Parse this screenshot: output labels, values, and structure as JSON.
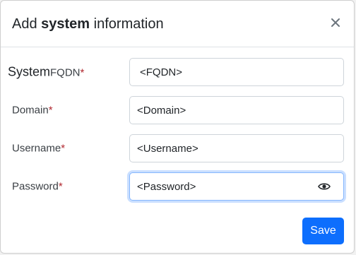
{
  "dialog": {
    "title_prefix": "Add ",
    "title_bold": "system",
    "title_suffix": "information",
    "close_glyph": "×",
    "save_label": "Save"
  },
  "fields": [
    {
      "label_big": "System",
      "label_small": "FQDN",
      "required_mark": "*",
      "value": "<FQDN>"
    },
    {
      "label": "Domain",
      "required_mark": "*",
      "value": "<Domain>"
    },
    {
      "label": "Username",
      "required_mark": "*",
      "value": "<Username>"
    },
    {
      "label": "Password",
      "required_mark": "*",
      "value": "<Password>",
      "icon": "eye-icon"
    }
  ],
  "colors": {
    "accent": "#0d6efd",
    "required": "#b0262d",
    "focus_border": "#86b7fe"
  }
}
